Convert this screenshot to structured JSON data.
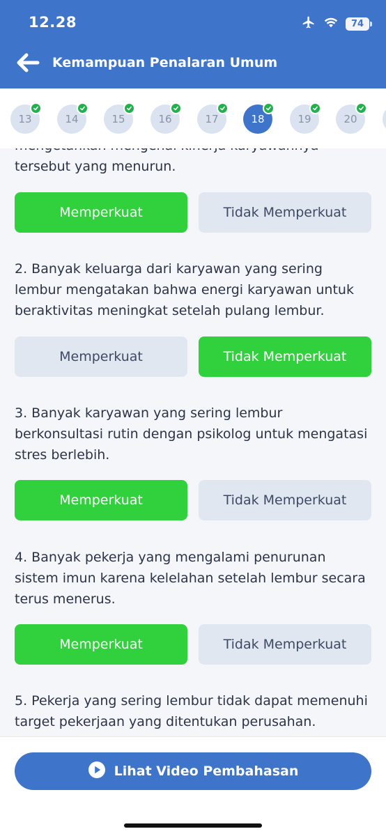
{
  "status": {
    "time": "12.28",
    "battery": "74"
  },
  "header": {
    "title": "Kemampuan Penalaran Umum"
  },
  "nav": [
    {
      "number": "13",
      "answered": true,
      "active": false
    },
    {
      "number": "14",
      "answered": true,
      "active": false
    },
    {
      "number": "15",
      "answered": true,
      "active": false
    },
    {
      "number": "16",
      "answered": true,
      "active": false
    },
    {
      "number": "17",
      "answered": true,
      "active": false
    },
    {
      "number": "18",
      "answered": true,
      "active": true
    },
    {
      "number": "19",
      "answered": true,
      "active": false
    },
    {
      "number": "20",
      "answered": true,
      "active": false
    }
  ],
  "questions": [
    {
      "text": "mengetahkan mengenai kinerja karyawannya tersebut yang menurun.",
      "options": [
        "Memperkuat",
        "Tidak Memperkuat"
      ],
      "selected": 0
    },
    {
      "text": "2. Banyak keluarga dari karyawan yang sering lembur mengatakan bahwa energi karyawan untuk beraktivitas meningkat setelah pulang lembur.",
      "options": [
        "Memperkuat",
        "Tidak Memperkuat"
      ],
      "selected": 1
    },
    {
      "text": "3. Banyak karyawan yang sering lembur berkonsultasi rutin dengan psikolog untuk mengatasi stres berlebih.",
      "options": [
        "Memperkuat",
        "Tidak Memperkuat"
      ],
      "selected": 0
    },
    {
      "text": "4. Banyak pekerja yang mengalami penurunan sistem imun karena kelelahan setelah lembur secara terus menerus.",
      "options": [
        "Memperkuat",
        "Tidak Memperkuat"
      ],
      "selected": 0
    },
    {
      "text": "5. Pekerja yang sering lembur tidak dapat memenuhi target pekerjaan yang ditentukan perusahan."
    }
  ],
  "footer": {
    "video_label": "Lihat Video Pembahasan"
  },
  "colors": {
    "primary": "#3e74c9",
    "selected": "#30d13c",
    "unselected": "#e1e7f1",
    "check": "#21b14a"
  }
}
